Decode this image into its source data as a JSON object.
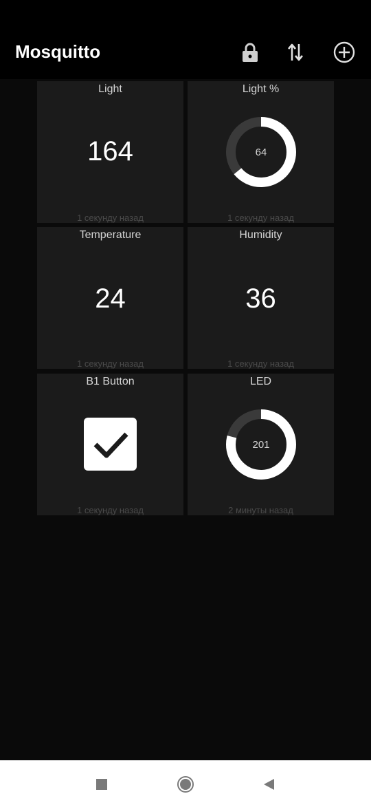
{
  "app": {
    "title": "Mosquitto"
  },
  "toolbar": {
    "lock_icon": "lock-icon",
    "sync_icon": "swap-vertical-icon",
    "add_icon": "add-circle-icon"
  },
  "tiles": [
    {
      "title": "Light",
      "value": "164",
      "time": "1 секунду назад",
      "kind": "text"
    },
    {
      "title": "Light %",
      "value": "64",
      "time": "1 секунду назад",
      "kind": "gauge",
      "fraction": 0.64
    },
    {
      "title": "Temperature",
      "value": "24",
      "time": "1 секунду назад",
      "kind": "text"
    },
    {
      "title": "Humidity",
      "value": "36",
      "time": "1 секунду назад",
      "kind": "text"
    },
    {
      "title": "B1 Button",
      "checked": true,
      "time": "1 секунду назад",
      "kind": "checkbox"
    },
    {
      "title": "LED",
      "value": "201",
      "time": "2 минуты назад",
      "kind": "gauge",
      "fraction": 0.79
    }
  ],
  "colors": {
    "background": "#0a0a0a",
    "tile": "#1b1b1b",
    "gauge_track": "#3a3a3a",
    "gauge_fill": "#ffffff",
    "navbar": "#ffffff"
  },
  "navbar": {
    "icons": [
      "recents-square-icon",
      "home-circle-icon",
      "back-triangle-icon"
    ]
  }
}
